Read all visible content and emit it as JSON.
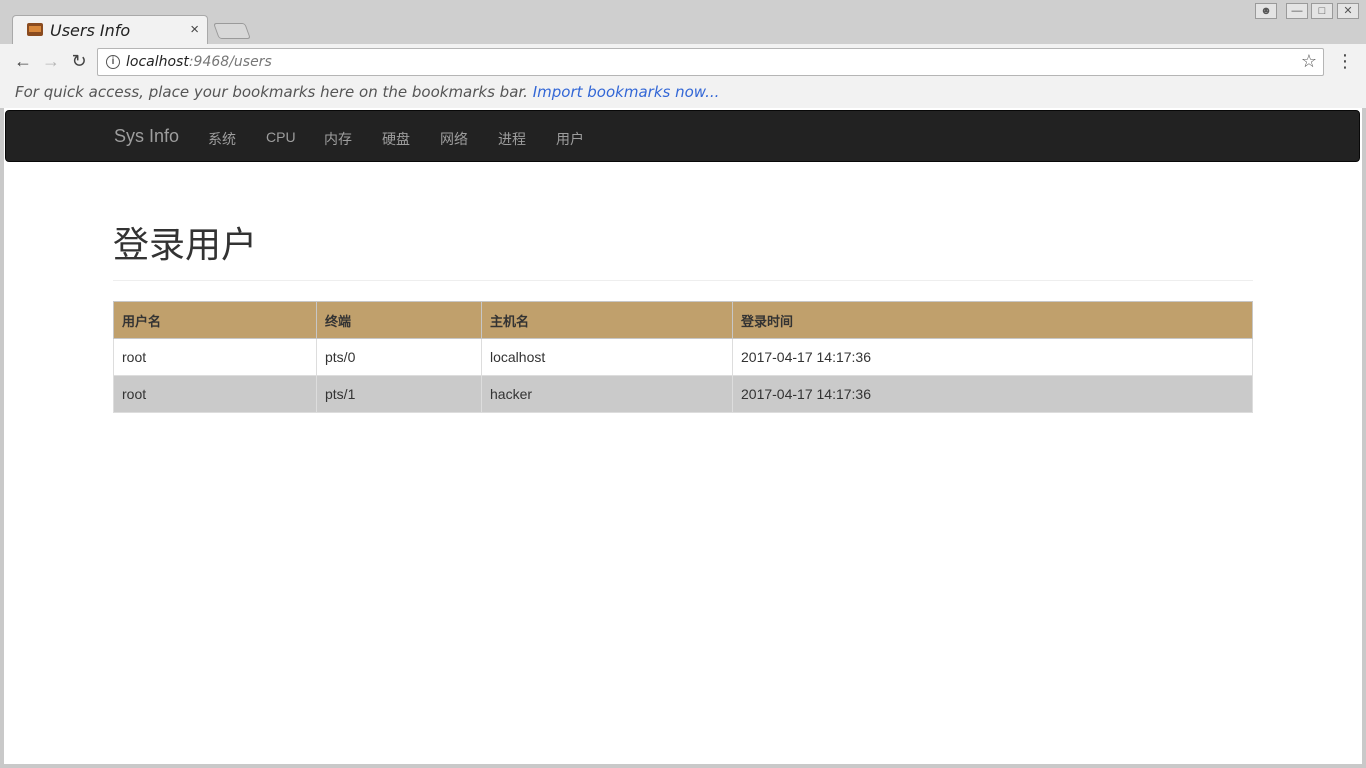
{
  "browser": {
    "tab_title": "Users Info",
    "tab_close": "×",
    "url_host": "localhost",
    "url_path": ":9468/users",
    "bookmarks_text": "For quick access, place your bookmarks here on the bookmarks bar.",
    "bookmarks_link": "Import bookmarks now..."
  },
  "navbar": {
    "brand": "Sys Info",
    "links": [
      "系统",
      "CPU",
      "内存",
      "硬盘",
      "网络",
      "进程",
      "用户"
    ]
  },
  "page": {
    "title": "登录用户"
  },
  "table": {
    "headers": [
      "用户名",
      "终端",
      "主机名",
      "登录时间"
    ],
    "rows": [
      [
        "root",
        "pts/0",
        "localhost",
        "2017-04-17 14:17:36"
      ],
      [
        "root",
        "pts/1",
        "hacker",
        "2017-04-17 14:17:36"
      ]
    ]
  },
  "colors": {
    "table_header": "#c0a06c",
    "navbar_bg": "#222222",
    "striped_row": "#cacaca"
  }
}
